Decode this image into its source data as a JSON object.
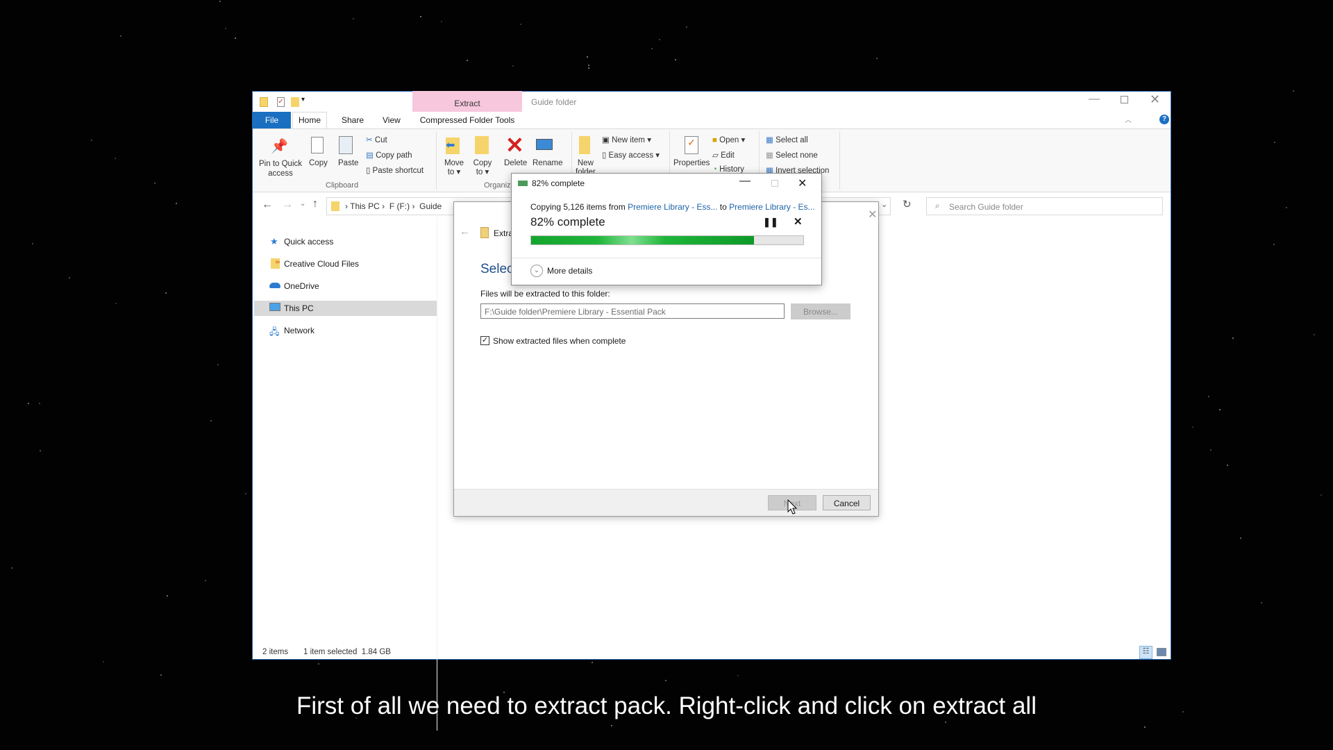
{
  "window": {
    "title": "Guide folder",
    "contextual_tab": "Extract",
    "colors": {
      "file_tab": "#1a6fc1",
      "contextual": "#f7c8dd",
      "progress": "#1fb53a",
      "link": "#1e63a8"
    }
  },
  "tabs": [
    {
      "label": "File"
    },
    {
      "label": "Home"
    },
    {
      "label": "Share"
    },
    {
      "label": "View"
    },
    {
      "label": "Compressed Folder Tools"
    }
  ],
  "ribbon": {
    "clipboard": {
      "pin": "Pin to Quick",
      "pin2": "access",
      "copy": "Copy",
      "paste": "Paste",
      "cut": "Cut",
      "copy_path": "Copy path",
      "paste_shortcut": "Paste shortcut",
      "group": "Clipboard"
    },
    "organize": {
      "move": "Move",
      "move2": "to",
      "copy": "Copy",
      "copy2": "to",
      "delete": "Delete",
      "rename": "Rename",
      "group": "Organiz"
    },
    "new": {
      "new_folder": "New",
      "new_folder2": "folder",
      "new_item": "New item",
      "easy_access": "Easy access"
    },
    "open": {
      "properties": "Properties",
      "open": "Open",
      "edit": "Edit",
      "history": "History"
    },
    "select": {
      "all": "Select all",
      "none": "Select none",
      "invert": "Invert selection"
    }
  },
  "address": {
    "crumbs": [
      "This PC",
      "F (F:)",
      "Guide"
    ],
    "search_placeholder": "Search Guide folder"
  },
  "nav": [
    {
      "label": "Quick access"
    },
    {
      "label": "Creative Cloud Files"
    },
    {
      "label": "OneDrive"
    },
    {
      "label": "This PC",
      "selected": true
    },
    {
      "label": "Network"
    }
  ],
  "extract_dialog": {
    "title": "Extra",
    "heading": "Select",
    "dest_label": "Files will be extracted to this folder:",
    "dest_value": "F:\\Guide folder\\Premiere Library - Essential Pack",
    "browse": "Browse...",
    "show_files": "Show extracted files when complete",
    "show_files_checked": true,
    "next": "Next",
    "cancel": "Cancel"
  },
  "copy_dialog": {
    "title": "82% complete",
    "copying_prefix": "Copying 5,126 items from",
    "source": "Premiere Library - Ess...",
    "to": "to",
    "dest": "Premiere Library - Es...",
    "status": "82% complete",
    "progress": 82,
    "more_details": "More details"
  },
  "status": {
    "items": "2 items",
    "selected": "1 item selected",
    "size": "1.84 GB"
  },
  "subtitle": "First of all we need to extract pack. Right-click and click on extract all"
}
